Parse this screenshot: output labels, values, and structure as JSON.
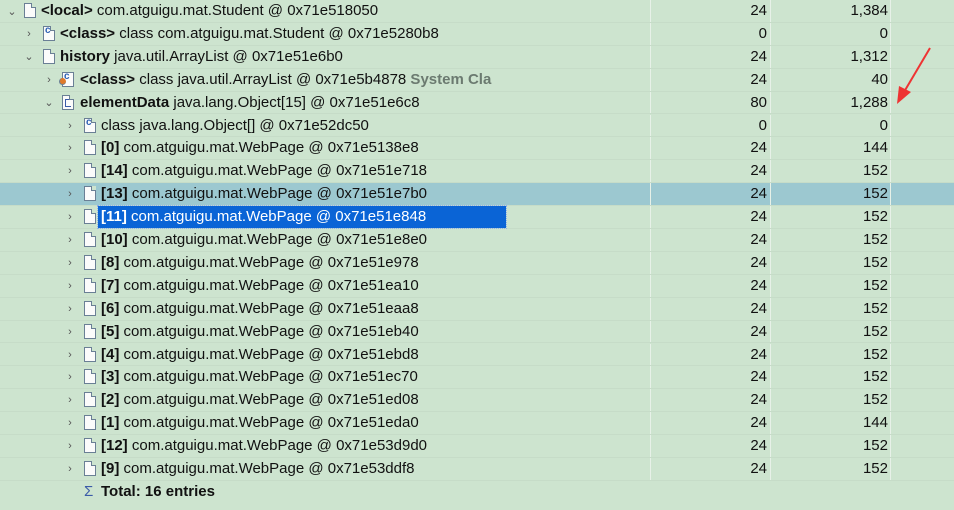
{
  "rows": [
    {
      "expander": "⌄",
      "icon": "doc",
      "bold": "<local>",
      "text": " com.atguigu.mat.Student @ 0x71e518050",
      "tag": "",
      "shallow": "24",
      "retained": "1,384",
      "state": "normal"
    },
    {
      "expander": "›",
      "icon": "cls",
      "bold": "<class>",
      "text": " class com.atguigu.mat.Student @ 0x71e5280b8",
      "tag": "",
      "shallow": "0",
      "retained": "0",
      "state": "normal"
    },
    {
      "expander": "⌄",
      "icon": "doc",
      "bold": "history",
      "text": " java.util.ArrayList @ 0x71e51e6b0",
      "tag": "",
      "shallow": "24",
      "retained": "1,312",
      "state": "normal"
    },
    {
      "expander": "›",
      "icon": "sys",
      "bold": "<class>",
      "text": " class java.util.ArrayList @ 0x71e5b4878",
      "tag": " System Cla",
      "shallow": "24",
      "retained": "40",
      "state": "normal"
    },
    {
      "expander": "⌄",
      "icon": "array",
      "bold": "elementData",
      "text": " java.lang.Object[15] @ 0x71e51e6c8",
      "tag": "",
      "shallow": "80",
      "retained": "1,288",
      "state": "normal"
    },
    {
      "expander": "›",
      "icon": "cls",
      "bold": "",
      "text": "class java.lang.Object[] @ 0x71e52dc50",
      "tag": "",
      "shallow": "0",
      "retained": "0",
      "state": "normal"
    },
    {
      "expander": "›",
      "icon": "doc",
      "bold": "[0]",
      "text": " com.atguigu.mat.WebPage @ 0x71e5138e8",
      "tag": "",
      "shallow": "24",
      "retained": "144",
      "state": "normal"
    },
    {
      "expander": "›",
      "icon": "doc",
      "bold": "[14]",
      "text": " com.atguigu.mat.WebPage @ 0x71e51e718",
      "tag": "",
      "shallow": "24",
      "retained": "152",
      "state": "normal"
    },
    {
      "expander": "›",
      "icon": "doc",
      "bold": "[13]",
      "text": " com.atguigu.mat.WebPage @ 0x71e51e7b0",
      "tag": "",
      "shallow": "24",
      "retained": "152",
      "state": "hover"
    },
    {
      "expander": "›",
      "icon": "doc",
      "bold": "[11]",
      "text": " com.atguigu.mat.WebPage @ 0x71e51e848",
      "tag": "",
      "shallow": "24",
      "retained": "152",
      "state": "selected"
    },
    {
      "expander": "›",
      "icon": "doc",
      "bold": "[10]",
      "text": " com.atguigu.mat.WebPage @ 0x71e51e8e0",
      "tag": "",
      "shallow": "24",
      "retained": "152",
      "state": "normal"
    },
    {
      "expander": "›",
      "icon": "doc",
      "bold": "[8]",
      "text": " com.atguigu.mat.WebPage @ 0x71e51e978",
      "tag": "",
      "shallow": "24",
      "retained": "152",
      "state": "normal"
    },
    {
      "expander": "›",
      "icon": "doc",
      "bold": "[7]",
      "text": " com.atguigu.mat.WebPage @ 0x71e51ea10",
      "tag": "",
      "shallow": "24",
      "retained": "152",
      "state": "normal"
    },
    {
      "expander": "›",
      "icon": "doc",
      "bold": "[6]",
      "text": " com.atguigu.mat.WebPage @ 0x71e51eaa8",
      "tag": "",
      "shallow": "24",
      "retained": "152",
      "state": "normal"
    },
    {
      "expander": "›",
      "icon": "doc",
      "bold": "[5]",
      "text": " com.atguigu.mat.WebPage @ 0x71e51eb40",
      "tag": "",
      "shallow": "24",
      "retained": "152",
      "state": "normal"
    },
    {
      "expander": "›",
      "icon": "doc",
      "bold": "[4]",
      "text": " com.atguigu.mat.WebPage @ 0x71e51ebd8",
      "tag": "",
      "shallow": "24",
      "retained": "152",
      "state": "normal"
    },
    {
      "expander": "›",
      "icon": "doc",
      "bold": "[3]",
      "text": " com.atguigu.mat.WebPage @ 0x71e51ec70",
      "tag": "",
      "shallow": "24",
      "retained": "152",
      "state": "normal"
    },
    {
      "expander": "›",
      "icon": "doc",
      "bold": "[2]",
      "text": " com.atguigu.mat.WebPage @ 0x71e51ed08",
      "tag": "",
      "shallow": "24",
      "retained": "152",
      "state": "normal"
    },
    {
      "expander": "›",
      "icon": "doc",
      "bold": "[1]",
      "text": " com.atguigu.mat.WebPage @ 0x71e51eda0",
      "tag": "",
      "shallow": "24",
      "retained": "144",
      "state": "normal"
    },
    {
      "expander": "›",
      "icon": "doc",
      "bold": "[12]",
      "text": " com.atguigu.mat.WebPage @ 0x71e53d9d0",
      "tag": "",
      "shallow": "24",
      "retained": "152",
      "state": "normal"
    },
    {
      "expander": "›",
      "icon": "doc",
      "bold": "[9]",
      "text": " com.atguigu.mat.WebPage @ 0x71e53ddf8",
      "tag": "",
      "shallow": "24",
      "retained": "152",
      "state": "normal"
    }
  ],
  "total": {
    "icon": "sigma-icon",
    "glyph": "Σ",
    "label": "Total: 16 entries"
  },
  "annotation": {
    "color": "#ee3333"
  },
  "colors": {
    "background": "#cde4cf",
    "selection": "#0a64d6",
    "hover": "#9cc8d0"
  }
}
